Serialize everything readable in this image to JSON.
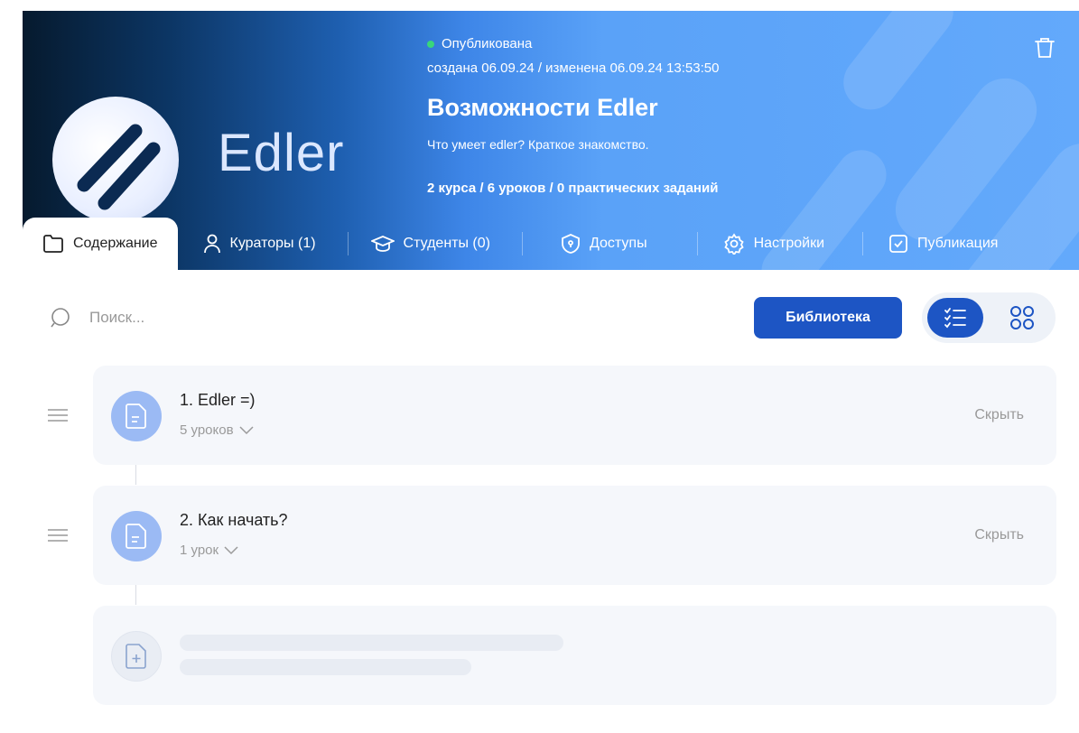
{
  "banner": {
    "logo_word": "Edler",
    "status": "Опубликована",
    "dates": "создана 06.09.24 / изменена 06.09.24 13:53:50",
    "title": "Возможности Edler",
    "description": "Что умеет edler? Краткое знакомство.",
    "stats": "2 курса / 6 уроков / 0 практических заданий",
    "status_color": "#39d67a"
  },
  "tabs": [
    {
      "label": "Содержание",
      "icon": "folder-icon",
      "active": true
    },
    {
      "label": "Кураторы (1)",
      "icon": "user-icon"
    },
    {
      "label": "Студенты (0)",
      "icon": "graduation-cap-icon"
    },
    {
      "label": "Доступы",
      "icon": "lock-icon"
    },
    {
      "label": "Настройки",
      "icon": "gear-icon"
    },
    {
      "label": "Публикация",
      "icon": "check-square-icon"
    }
  ],
  "toolbar": {
    "search_placeholder": "Поиск...",
    "library_label": "Библиотека"
  },
  "courses": [
    {
      "title": "1. Edler =)",
      "lessons": "5 уроков",
      "hide_label": "Скрыть"
    },
    {
      "title": "2. Как начать?",
      "lessons": "1 урок",
      "hide_label": "Скрыть"
    }
  ],
  "colors": {
    "accent": "#1d55c4",
    "card_bg": "#f5f7fb",
    "icon_bg": "#9bbaf4"
  }
}
